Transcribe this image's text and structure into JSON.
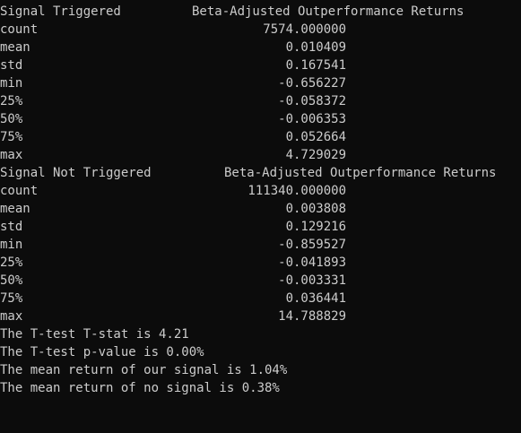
{
  "terminal": {
    "group1": {
      "title": "Signal Triggered",
      "column_header": "Beta-Adjusted Outperformance Returns",
      "rows": [
        {
          "label": "count",
          "value": "7574.000000"
        },
        {
          "label": "mean",
          "value": "0.010409"
        },
        {
          "label": "std",
          "value": "0.167541"
        },
        {
          "label": "min",
          "value": "-0.656227"
        },
        {
          "label": "25%",
          "value": "-0.058372"
        },
        {
          "label": "50%",
          "value": "-0.006353"
        },
        {
          "label": "75%",
          "value": "0.052664"
        },
        {
          "label": "max",
          "value": "4.729029"
        }
      ]
    },
    "group2": {
      "title": "Signal Not Triggered",
      "column_header": "Beta-Adjusted Outperformance Returns",
      "rows": [
        {
          "label": "count",
          "value": "111340.000000"
        },
        {
          "label": "mean",
          "value": "0.003808"
        },
        {
          "label": "std",
          "value": "0.129216"
        },
        {
          "label": "min",
          "value": "-0.859527"
        },
        {
          "label": "25%",
          "value": "-0.041893"
        },
        {
          "label": "50%",
          "value": "-0.003331"
        },
        {
          "label": "75%",
          "value": "0.036441"
        },
        {
          "label": "max",
          "value": "14.788829"
        }
      ]
    },
    "summary": [
      "The T-test T-stat is 4.21",
      "The T-test p-value is 0.00%",
      "The mean return of our signal is 1.04%",
      "The mean return of no signal is 0.38%"
    ]
  }
}
